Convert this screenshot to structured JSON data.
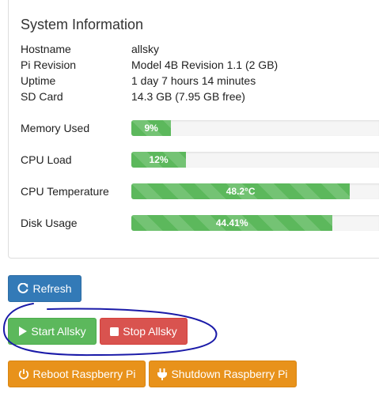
{
  "panel": {
    "title": "System Information",
    "info": [
      {
        "label": "Hostname",
        "value": "allsky"
      },
      {
        "label": "Pi Revision",
        "value": "Model 4B Revision 1.1 (2 GB)"
      },
      {
        "label": "Uptime",
        "value": "1 day 7 hours 14 minutes"
      },
      {
        "label": "SD Card",
        "value": "14.3 GB (7.95 GB free)"
      }
    ],
    "metrics": [
      {
        "label": "Memory Used",
        "text": "9%",
        "percent": 16
      },
      {
        "label": "CPU Load",
        "text": "12%",
        "percent": 22
      },
      {
        "label": "CPU Temperature",
        "text": "48.2°C",
        "percent": 88
      },
      {
        "label": "Disk Usage",
        "text": "44.41%",
        "percent": 81
      }
    ]
  },
  "buttons": {
    "refresh": "Refresh",
    "start": "Start Allsky",
    "stop": "Stop Allsky",
    "reboot": "Reboot Raspberry Pi",
    "shutdown": "Shutdown Raspberry Pi"
  },
  "colors": {
    "primary": "#337ab7",
    "success": "#5cb85c",
    "danger": "#d9534f",
    "warning": "#e8921b",
    "annotation": "#1a1aa8"
  },
  "icons": {
    "refresh": "refresh-icon",
    "start": "play-icon",
    "stop": "stop-icon",
    "reboot": "power-icon",
    "shutdown": "plug-icon"
  }
}
